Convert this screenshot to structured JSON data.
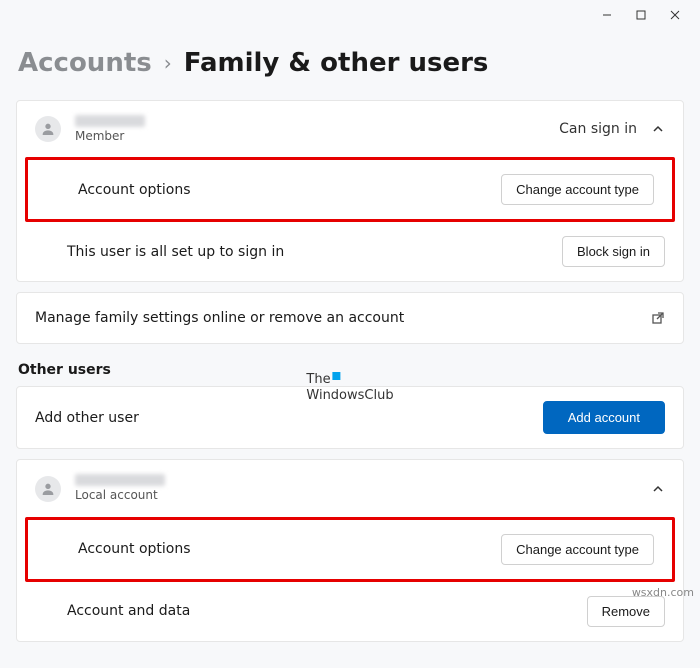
{
  "titlebar": {
    "min": "",
    "max": "",
    "close": ""
  },
  "breadcrumb": {
    "parent": "Accounts",
    "sep": "›",
    "current": "Family & other users"
  },
  "family_user": {
    "role": "Member",
    "status": "Can sign in",
    "account_options_label": "Account options",
    "change_type_label": "Change account type",
    "setup_text": "This user is all set up to sign in",
    "block_label": "Block sign in"
  },
  "manage_family": {
    "text": "Manage family settings online or remove an account"
  },
  "other_users_heading": "Other users",
  "add_other_user": {
    "text": "Add other user",
    "button": "Add account"
  },
  "local_user": {
    "role": "Local account",
    "account_options_label": "Account options",
    "change_type_label": "Change account type",
    "data_label": "Account and data",
    "remove_label": "Remove"
  },
  "watermark": {
    "line1": "The",
    "line2": "WindowsClub"
  },
  "footer": "wsxdn.com"
}
